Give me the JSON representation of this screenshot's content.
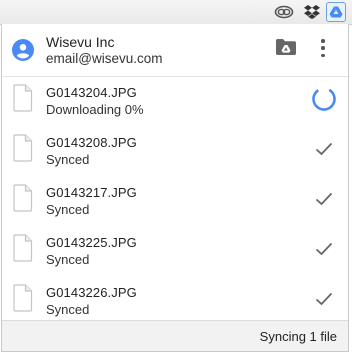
{
  "account": {
    "name": "Wisevu Inc",
    "email": "email@wisevu.com"
  },
  "files": [
    {
      "name": "G0143204.JPG",
      "status": "Downloading 0%",
      "state": "syncing"
    },
    {
      "name": "G0143208.JPG",
      "status": "Synced",
      "state": "synced"
    },
    {
      "name": "G0143217.JPG",
      "status": "Synced",
      "state": "synced"
    },
    {
      "name": "G0143225.JPG",
      "status": "Synced",
      "state": "synced"
    },
    {
      "name": "G0143226.JPG",
      "status": "Synced",
      "state": "synced"
    }
  ],
  "footer": {
    "status": "Syncing 1 file"
  },
  "toolbar_icons": [
    "creative-cloud-icon",
    "dropbox-icon",
    "google-drive-icon"
  ],
  "colors": {
    "accent": "#4a8af4",
    "icon_gray": "#666666"
  }
}
